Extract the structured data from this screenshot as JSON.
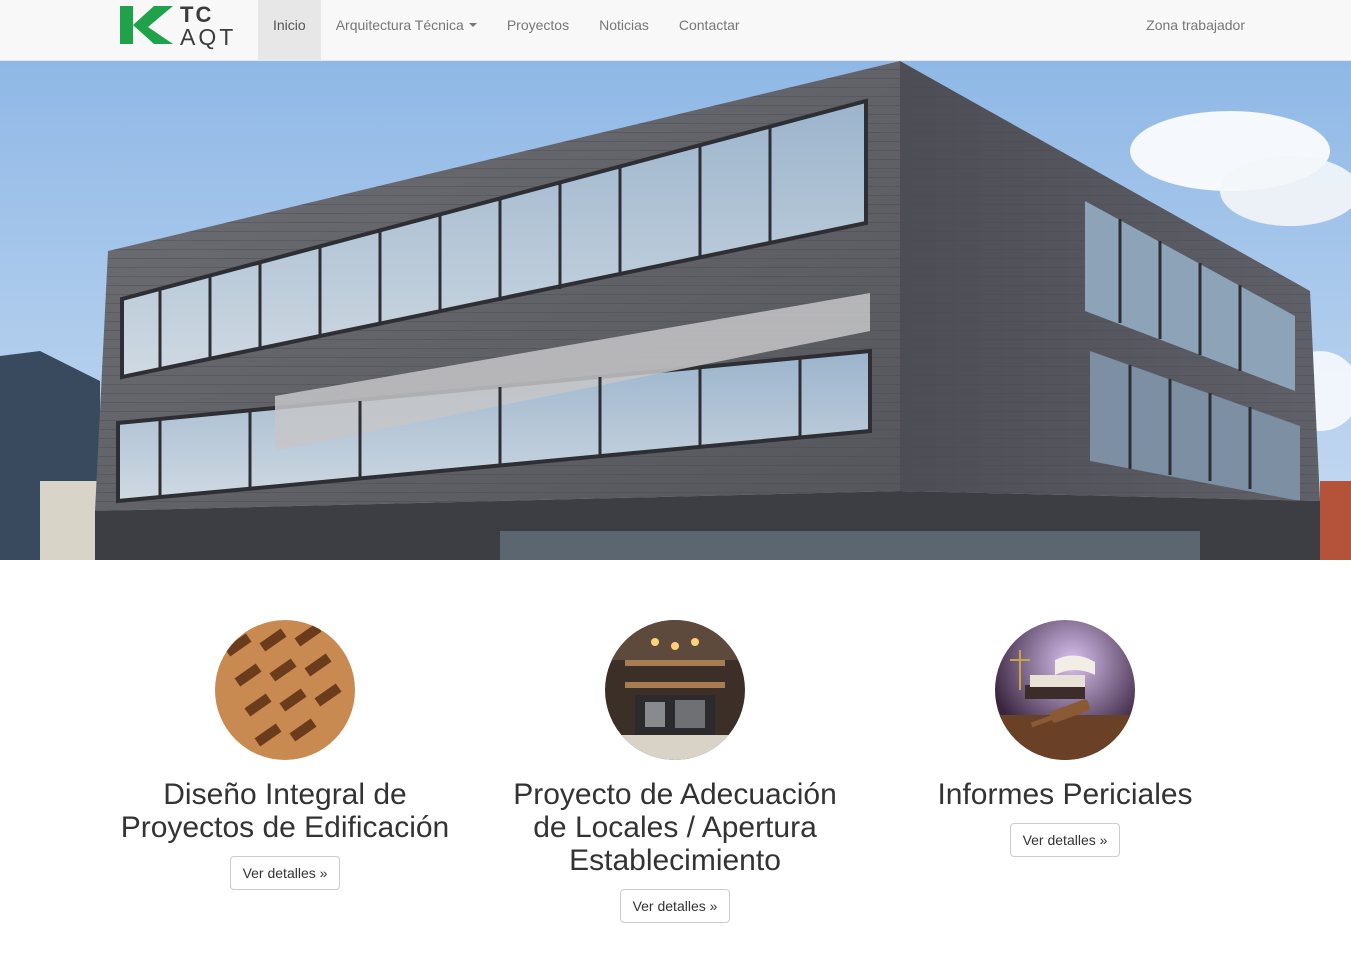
{
  "brand": {
    "line1": "TC",
    "line2": "AQT",
    "logo_icon": "tc-aqt-logo-icon",
    "accent_color": "#1fa24a"
  },
  "nav": {
    "items": [
      {
        "label": "Inicio",
        "active": true
      },
      {
        "label": "Arquitectura Técnica",
        "dropdown": true
      },
      {
        "label": "Proyectos"
      },
      {
        "label": "Noticias"
      },
      {
        "label": "Contactar"
      }
    ],
    "right_label": "Zona trabajador"
  },
  "hero": {
    "image": "modern-office-building-photo"
  },
  "features": [
    {
      "title": "Diseño Integral de Proyectos de Edificación",
      "button": "Ver detalles »",
      "image": "brick-pattern-photo"
    },
    {
      "title": "Proyecto de Adecuación de Locales / Apertura Establecimiento",
      "button": "Ver detalles »",
      "image": "cafe-interior-photo"
    },
    {
      "title": "Informes Periciales",
      "button": "Ver detalles »",
      "image": "law-books-gavel-photo"
    }
  ]
}
